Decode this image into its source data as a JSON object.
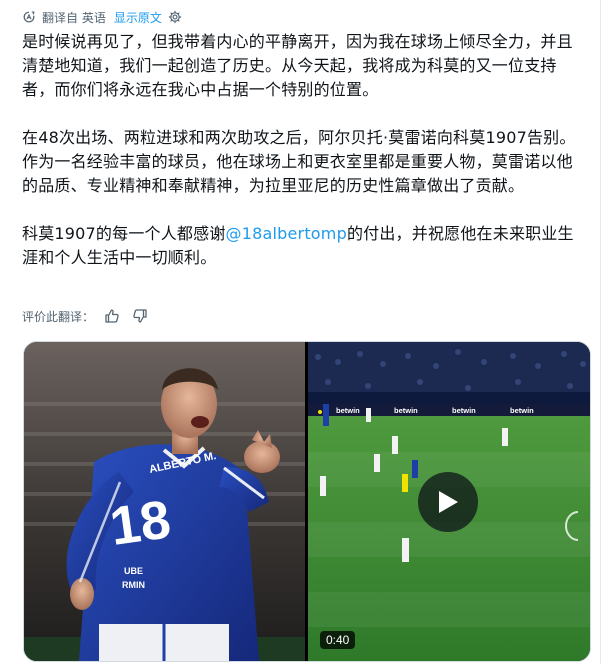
{
  "translation": {
    "translated_from": "翻译自 英语",
    "show_original": "显示原文",
    "translate_icon": "translate-icon",
    "settings_icon": "gear-icon"
  },
  "post": {
    "paragraph1": "是时候说再见了，但我带着内心的平静离开，因为我在球场上倾尽全力，并且清楚地知道，我们一起创造了历史。从今天起，我将成为科莫的又一位支持者，而你们将永远在我心中占据一个特别的位置。",
    "paragraph2": "在48次出场、两粒进球和两次助攻之后，阿尔贝托·莫雷诺向科莫1907告别。作为一名经验丰富的球员，他在球场上和更衣室里都是重要人物，莫雷诺以他的品质、专业精神和奉献精神，为拉里亚尼的历史性篇章做出了贡献。",
    "paragraph3_before": "科莫1907的每一个人都感谢",
    "mention": "@18albertomp",
    "paragraph3_after": "的付出，并祝愿他在未来职业生涯和个人生活中一切顺利。"
  },
  "rating": {
    "label": "评价此翻译：",
    "like_icon": "thumbs-up-icon",
    "dislike_icon": "thumbs-down-icon"
  },
  "media": {
    "photo": {
      "jersey_number": "18",
      "jersey_name": "ALBERTO M.",
      "sponsor": "UBE\nMIN"
    },
    "video": {
      "duration": "0:40",
      "play_icon": "play-icon",
      "board_text": "betwin 360.tv"
    }
  },
  "colors": {
    "link": "#1d9bf0",
    "secondary_text": "#536471",
    "kit_blue": "#1e3fa8",
    "pitch_green": "#3f8a33"
  }
}
